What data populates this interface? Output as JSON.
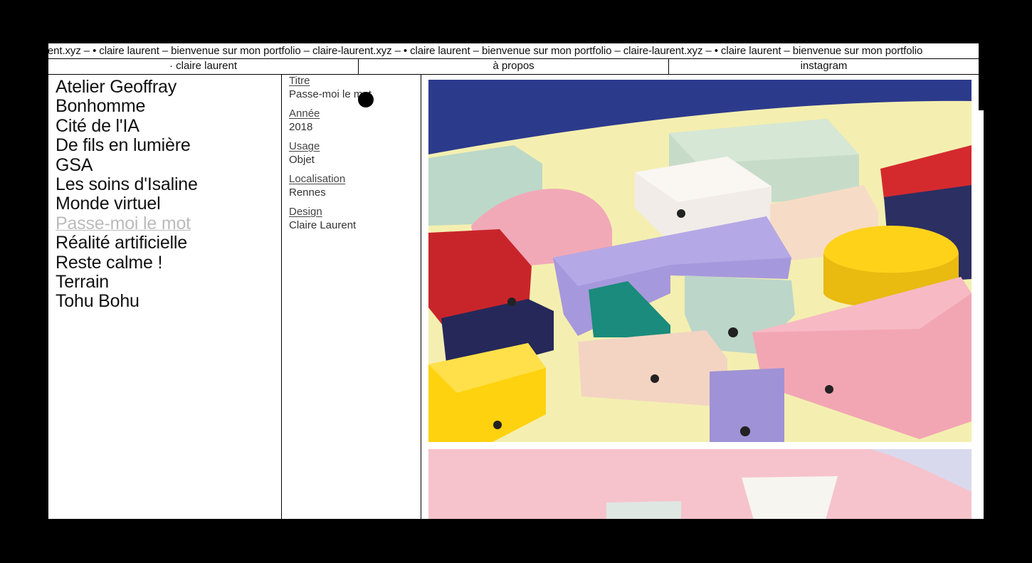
{
  "marquee": {
    "text": "rent.xyz – • claire laurent – bienvenue sur mon portfolio – claire-laurent.xyz – • claire laurent – bienvenue sur mon portfolio – claire-laurent.xyz – • claire laurent – bienvenue sur mon portfolio"
  },
  "nav": {
    "home": "· claire laurent",
    "about": "à propos",
    "instagram": "instagram"
  },
  "projects": [
    "Atelier Geoffray",
    "Bonhomme",
    "Cité de l'IA",
    "De fils en lumière",
    "GSA",
    "Les soins d'Isaline",
    "Monde virtuel",
    "Passe-moi le mot",
    "Réalité artificielle",
    "Reste calme !",
    "Terrain",
    "Tohu Bohu"
  ],
  "active_project": "Passe-moi le mot",
  "meta": {
    "title_label": "Titre",
    "title_value": "Passe-moi le mot",
    "year_label": "Année",
    "year_value": "2018",
    "usage_label": "Usage",
    "usage_value": "Objet",
    "location_label": "Localisation",
    "location_value": "Rennes",
    "design_label": "Design",
    "design_value": "Claire Laurent"
  },
  "colors": {
    "background": "#000000",
    "page": "#ffffff",
    "active_project": "#bbbbbb"
  }
}
